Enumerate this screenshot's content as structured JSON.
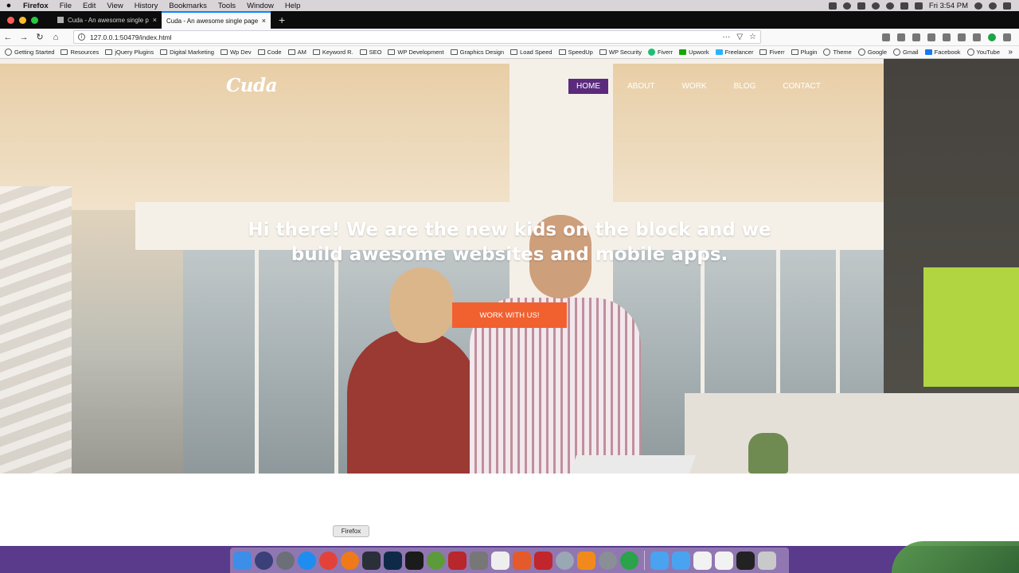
{
  "menubar": {
    "app": "Firefox",
    "items": [
      "File",
      "Edit",
      "View",
      "History",
      "Bookmarks",
      "Tools",
      "Window",
      "Help"
    ],
    "clock": "Fri 3:54 PM"
  },
  "tabs": [
    {
      "title": "Cuda - An awesome single pag",
      "close": "×"
    },
    {
      "title": "Cuda - An awesome single page po",
      "close": "×"
    }
  ],
  "browser": {
    "new_tab": "+",
    "url": "127.0.0.1:50479/index.html",
    "url_actions": "···"
  },
  "bookmarks": [
    {
      "label": "Getting Started",
      "icon": "globe-icon"
    },
    {
      "label": "Resources",
      "icon": "folder-icon"
    },
    {
      "label": "jQuery Plugins",
      "icon": "folder-icon"
    },
    {
      "label": "Digital Marketing",
      "icon": "folder-icon"
    },
    {
      "label": "Wp Dev",
      "icon": "folder-icon"
    },
    {
      "label": "Code",
      "icon": "folder-icon"
    },
    {
      "label": "AM",
      "icon": "folder-icon"
    },
    {
      "label": "Keyword R.",
      "icon": "folder-icon"
    },
    {
      "label": "SEO",
      "icon": "folder-icon"
    },
    {
      "label": "WP Development",
      "icon": "folder-icon"
    },
    {
      "label": "Graphics Design",
      "icon": "folder-icon"
    },
    {
      "label": "Load Speed",
      "icon": "folder-icon"
    },
    {
      "label": "SpeedUp",
      "icon": "folder-icon"
    },
    {
      "label": "WP Security",
      "icon": "folder-icon"
    },
    {
      "label": "Fiverr",
      "icon": "fiverr-icon"
    },
    {
      "label": "Upwork",
      "icon": "upwork-icon"
    },
    {
      "label": "Freelancer",
      "icon": "freelancer-icon"
    },
    {
      "label": "Fiverr",
      "icon": "folder-icon"
    },
    {
      "label": "Plugin",
      "icon": "folder-icon"
    },
    {
      "label": "Theme",
      "icon": "search-icon"
    },
    {
      "label": "Google",
      "icon": "globe-icon"
    },
    {
      "label": "Gmail",
      "icon": "globe-icon"
    },
    {
      "label": "Facebook",
      "icon": "facebook-icon"
    },
    {
      "label": "YouTube",
      "icon": "globe-icon"
    }
  ],
  "site": {
    "logo": "Cuda",
    "nav": [
      "HOME",
      "ABOUT",
      "WORK",
      "BLOG",
      "CONTACT"
    ],
    "headline": "Hi there! We are the new kids on the block and we build awesome websites and mobile apps.",
    "cta": "WORK WITH US!"
  },
  "dock": {
    "tooltip": "Firefox"
  },
  "colors": {
    "nav_active": "#5b2a7d",
    "cta": "#f1602f"
  }
}
